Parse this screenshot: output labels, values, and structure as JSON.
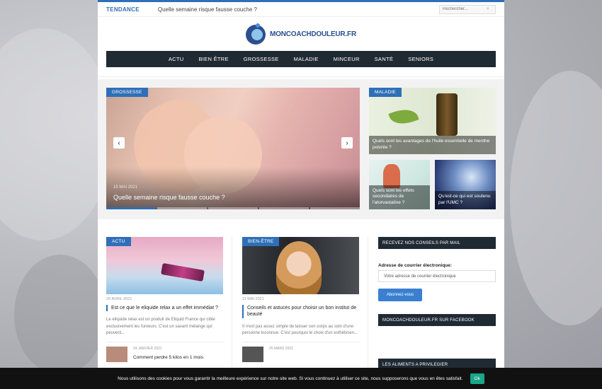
{
  "topbar": {
    "trending_label": "TENDANCE",
    "trending_text": "Quelle semaine risque fausse couche ?",
    "search_placeholder": "Rechercher..."
  },
  "logo": {
    "text": "MONCOACHDOULEUR.FR"
  },
  "nav": {
    "items": [
      "ACTU",
      "BIEN ÊTRE",
      "GROSSESSE",
      "MALADIE",
      "MINCEUR",
      "SANTÉ",
      "SENIORS"
    ]
  },
  "featured": {
    "slider": {
      "category": "GROSSESSE",
      "date": "15 MAI 2021",
      "title": "Quelle semaine risque fausse couche ?",
      "prev_icon": "‹",
      "next_icon": "›"
    },
    "tile1": {
      "category": "MALADIE",
      "title": "Quels sont les avantages de l'huile essentielle de menthe poivrée ?"
    },
    "tile2": {
      "title": "Quels sont les effets secondaires de l'atorvastatine ?"
    },
    "tile3": {
      "title": "Qu'est-ce qui est soutenu par l'UMC ?"
    }
  },
  "col1": {
    "category": "ACTU",
    "date": "20 AVRIL 2021",
    "title": "Est ce que le eliquide relax a un effet immédiat ?",
    "excerpt": "Le eliquide relax est un produit de Eliquid France qui cible exclusivement les fumeurs. C'est un savant mélange qui peuvent...",
    "mini_date": "24 JANVIER 2021",
    "mini_title": "Comment perdre 5 kilos en 1 mois"
  },
  "col2": {
    "category": "BIEN-ÊTRE",
    "date": "11 MAI 2021",
    "title": "Conseils et astuces pour choisir un bon institut de beauté",
    "excerpt": "Il n'est pas assez simple de laisser son corps au soin d'une personne inconnue. C'est pourquoi le choix d'un esthéticien...",
    "mini_date": "25 MARS 2021"
  },
  "sidebar": {
    "newsletter_title": "RECEVEZ NOS CONSEILS PAR MAIL",
    "email_label": "Adresse de courrier électronique:",
    "email_placeholder": "Votre adresse de courrier électronique",
    "subscribe_label": "Abonnez-vous",
    "facebook_title": "MONCOACHDOULEUR.FR SUR FACEBOOK",
    "foods_title": "LES ALIMENTS A PRIVILEGIER"
  },
  "cookie": {
    "text": "Nous utilisons des cookies pour vous garantir la meilleure expérience sur notre site web. Si vous continuez à utiliser ce site, nous supposerons que vous en êtes satisfait.",
    "ok_label": "Ok"
  },
  "colors": {
    "accent": "#2f6fb7",
    "nav_bg": "#202a33",
    "cookie_ok": "#1aa689"
  },
  "icons": {
    "search": "search-icon",
    "prev": "chevron-left-icon",
    "next": "chevron-right-icon"
  }
}
